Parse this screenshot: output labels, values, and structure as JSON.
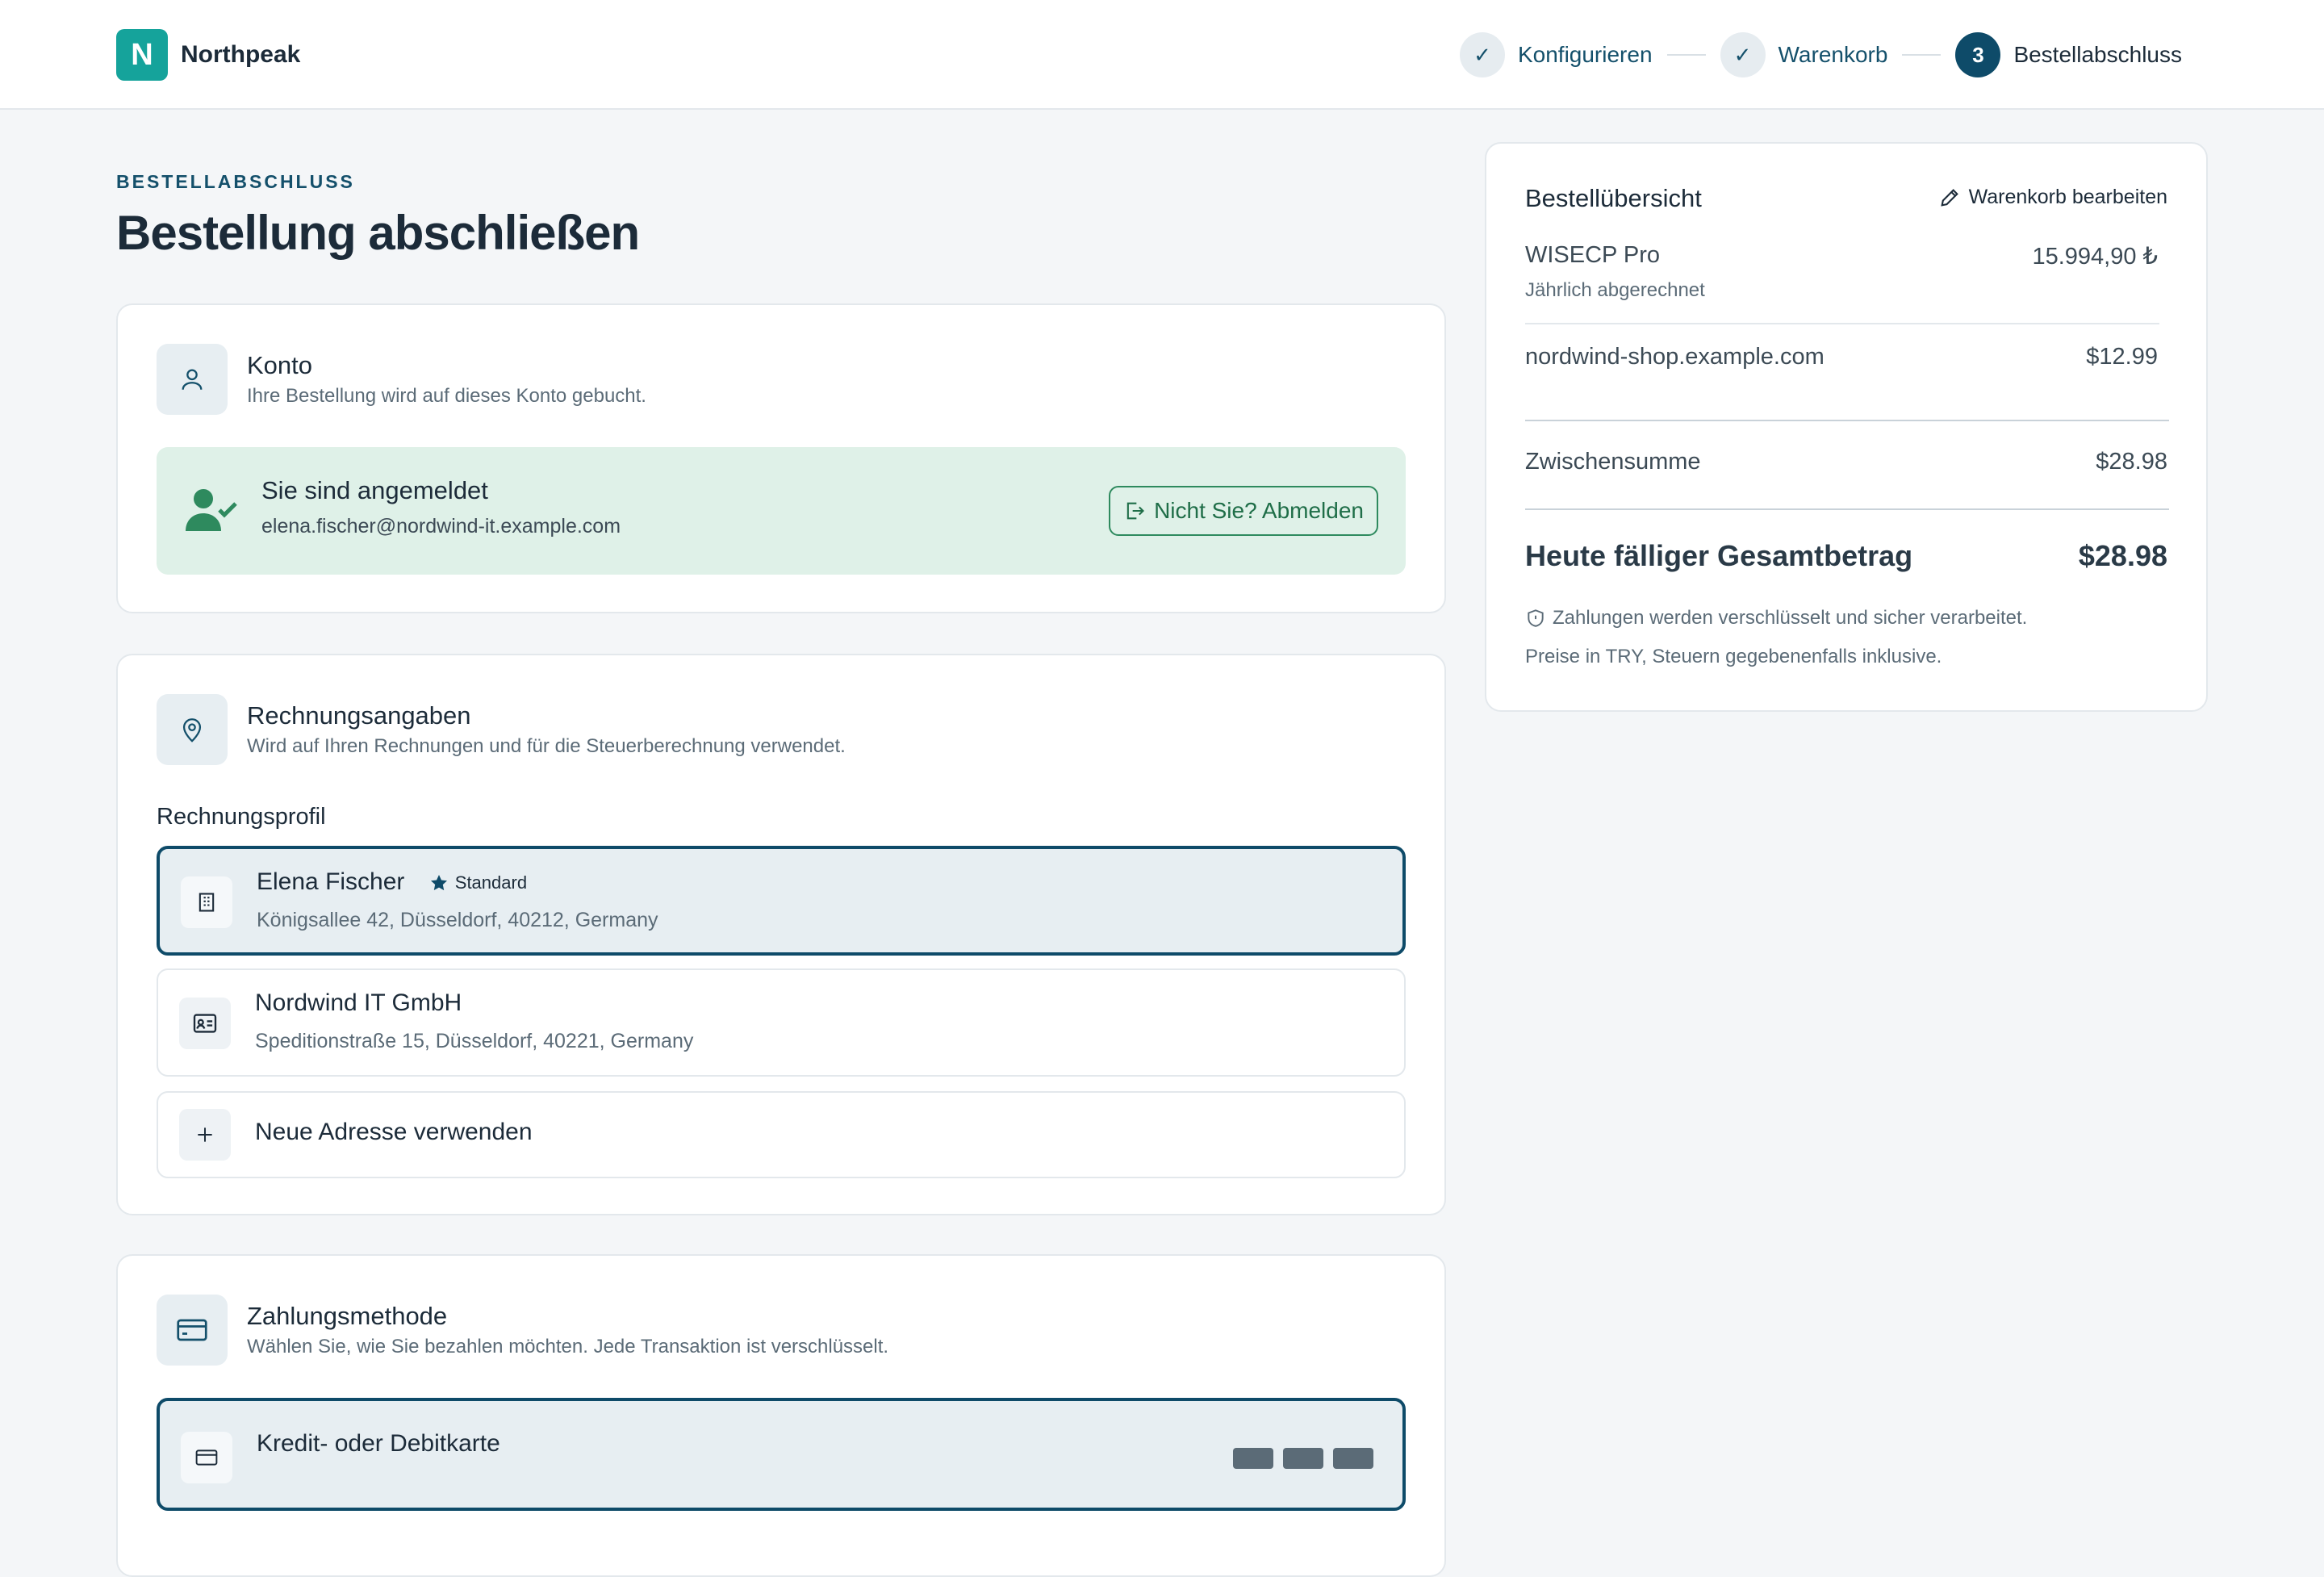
{
  "brand": {
    "logo_letter": "N",
    "name": "Northpeak"
  },
  "steps": [
    {
      "label": "Konfigurieren",
      "marker": "✓",
      "state": "done"
    },
    {
      "label": "Warenkorb",
      "marker": "✓",
      "state": "done"
    },
    {
      "label": "Bestellabschluss",
      "marker": "3",
      "state": "active"
    }
  ],
  "page": {
    "eyebrow": "BESTELLABSCHLUSS",
    "title": "Bestellung abschließen"
  },
  "account": {
    "title": "Konto",
    "subtitle": "Ihre Bestellung wird auf dieses Konto gebucht.",
    "login_title": "Sie sind angemeldet",
    "login_email": "elena.fischer@nordwind-it.example.com",
    "logout_label": "Nicht Sie? Abmelden"
  },
  "billing": {
    "title": "Rechnungsangaben",
    "subtitle": "Wird auf Ihren Rechnungen und für die Steuerberechnung verwendet.",
    "profile_label": "Rechnungsprofil",
    "profiles": [
      {
        "name": "Elena Fischer",
        "badge": "Standard",
        "address": "Königsallee 42, Düsseldorf, 40212, Germany",
        "icon": "building-icon",
        "selected": true
      },
      {
        "name": "Nordwind IT GmbH",
        "address": "Speditionstraße 15, Düsseldorf, 40221, Germany",
        "icon": "id-card-icon",
        "selected": false
      }
    ],
    "new_address_label": "Neue Adresse verwenden"
  },
  "payment": {
    "title": "Zahlungsmethode",
    "subtitle": "Wählen Sie, wie Sie bezahlen möchten. Jede Transaktion ist verschlüsselt.",
    "first_option": "Kredit- oder Debitkarte"
  },
  "summary": {
    "title": "Bestellübersicht",
    "edit_label": "Warenkorb bearbeiten",
    "items": [
      {
        "name": "WISECP Pro",
        "price": "15.994,90 ₺",
        "note": "Jährlich abgerechnet"
      },
      {
        "name": "nordwind-shop.example.com",
        "price": "$12.99"
      }
    ],
    "subtotal_label": "Zwischensumme",
    "subtotal_value": "$28.98",
    "total_label": "Heute fälliger Gesamtbetrag",
    "total_value": "$28.98",
    "secure_note": "Zahlungen werden verschlüsselt und sicher verarbeitet.",
    "tax_note": "Preise in TRY, Steuern gegebenenfalls inklusive."
  },
  "colors": {
    "brand": "#15a39b",
    "accent": "#0e4b69",
    "success_bg": "#dff1e8",
    "success": "#2e8a5e"
  }
}
